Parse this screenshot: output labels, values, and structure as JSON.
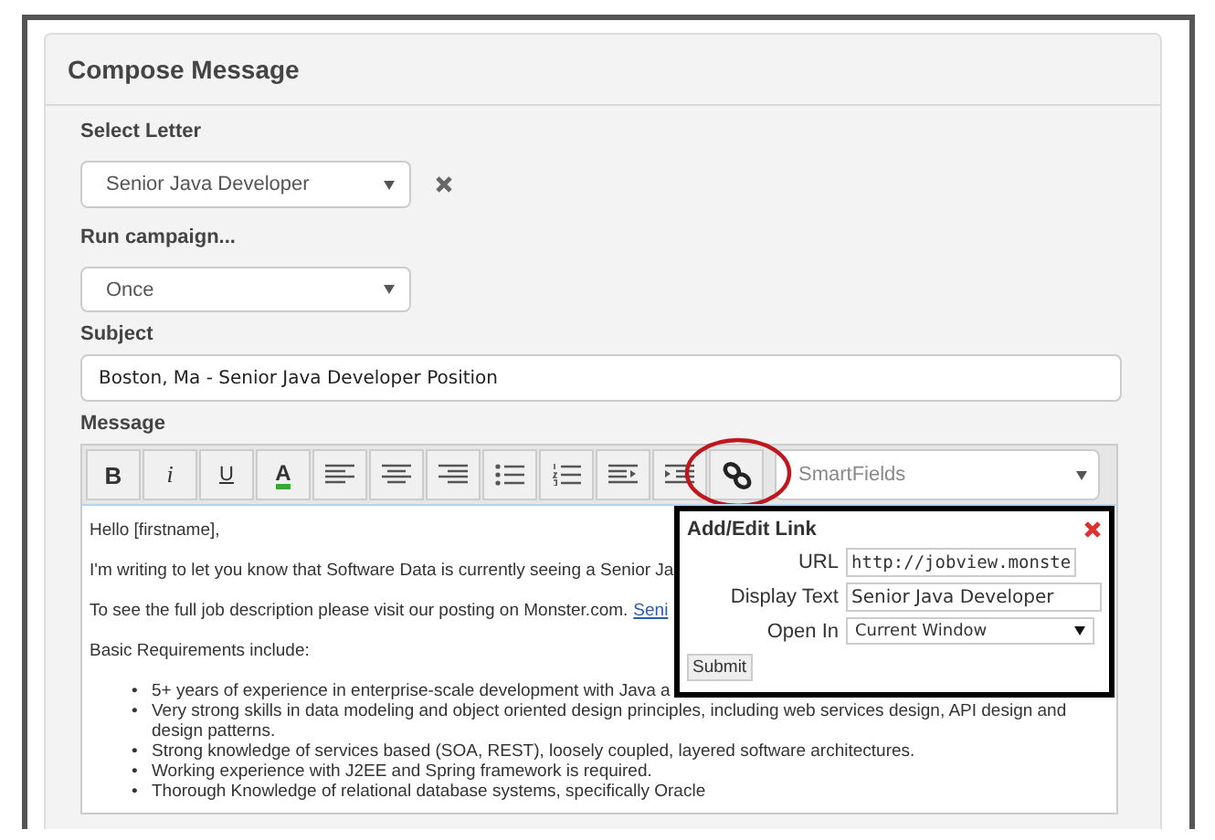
{
  "panel": {
    "title": "Compose Message"
  },
  "select_letter": {
    "label": "Select Letter",
    "value": "Senior Java Developer"
  },
  "run_campaign": {
    "label": "Run campaign...",
    "value": "Once"
  },
  "subject": {
    "label": "Subject",
    "value": "Boston, Ma - Senior Java Developer Position"
  },
  "message": {
    "label": "Message",
    "toolbar": [
      {
        "kind": "bold",
        "label": "B"
      },
      {
        "kind": "italic",
        "label": "i"
      },
      {
        "kind": "underline",
        "label": "U"
      },
      {
        "kind": "color",
        "label": "A"
      },
      {
        "kind": "align-left"
      },
      {
        "kind": "align-center"
      },
      {
        "kind": "align-right"
      },
      {
        "kind": "bullets"
      },
      {
        "kind": "numbers"
      },
      {
        "kind": "outdent"
      },
      {
        "kind": "indent"
      },
      {
        "kind": "link",
        "highlighted": true
      }
    ],
    "smartfields": "SmartFields",
    "paragraphs": [
      {
        "text": "Hello [firstname],"
      },
      {
        "text": "I'm writing to let you know that Software Data is currently seeing a Senior Ja"
      },
      {
        "text": "To see the full job description please visit our posting on Monster.com.",
        "link": "Seni"
      },
      {
        "text": "Basic Requirements include:"
      }
    ],
    "bullets": [
      {
        "marker": "•",
        "text": "5+ years of experience in enterprise-scale development with Java a"
      },
      {
        "marker": "•",
        "text": "Very strong skills in data modeling and object oriented design principles, including web services design, API design and design patterns."
      },
      {
        "marker": "•",
        "text": "Strong knowledge of services based (SOA, REST), loosely coupled, layered software architectures."
      },
      {
        "marker": "•",
        "text": "Working experience with J2EE and Spring framework is required."
      },
      {
        "marker": "•",
        "text": "Thorough Knowledge of relational database systems, specifically Oracle"
      }
    ]
  },
  "link_dialog": {
    "title": "Add/Edit Link",
    "fields": [
      {
        "kind": "input",
        "label": "URL",
        "value": "http://jobview.monste"
      },
      {
        "kind": "input",
        "label": "Display Text",
        "value": "Senior Java Developer"
      },
      {
        "kind": "select",
        "label": "Open In",
        "value": "Current Window"
      }
    ],
    "submit": "Submit"
  }
}
